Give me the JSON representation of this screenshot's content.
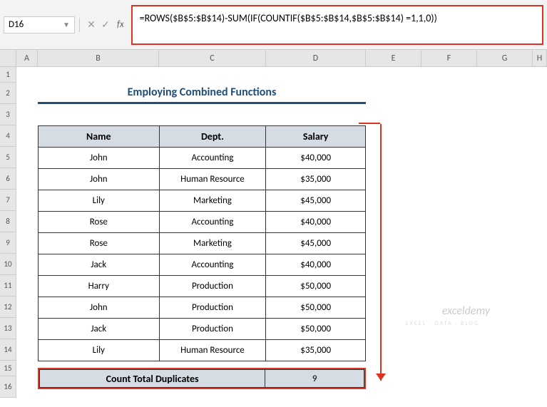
{
  "nameBox": {
    "cellRef": "D16"
  },
  "formulaBar": {
    "formula": "=ROWS($B$5:$B$14)-SUM(IF(COUNTIF($B$5:$B$14,$B$5:$B$14) =1,1,0))"
  },
  "columns": {
    "a": "A",
    "b": "B",
    "c": "C",
    "d": "D",
    "e": "E",
    "f": "F",
    "g": "G",
    "h": "H"
  },
  "rows": {
    "r1": "1",
    "r2": "2",
    "r3": "3",
    "r4": "4",
    "r5": "5",
    "r6": "6",
    "r7": "7",
    "r8": "8",
    "r9": "9",
    "r10": "10",
    "r11": "11",
    "r12": "12",
    "r13": "13",
    "r14": "14",
    "r15": "15",
    "r16": "16"
  },
  "title": "Employing Combined Functions",
  "headers": {
    "name": "Name",
    "dept": "Dept.",
    "salary": "Salary"
  },
  "data": [
    {
      "name": "John",
      "dept": "Accounting",
      "salary": "$40,000"
    },
    {
      "name": "John",
      "dept": "Human Resource",
      "salary": "$35,000"
    },
    {
      "name": "Lily",
      "dept": "Marketing",
      "salary": "$45,000"
    },
    {
      "name": "Rose",
      "dept": "Accounting",
      "salary": "$40,000"
    },
    {
      "name": "Rose",
      "dept": "Marketing",
      "salary": "$45,000"
    },
    {
      "name": "Jack",
      "dept": "Accounting",
      "salary": "$40,000"
    },
    {
      "name": "Harry",
      "dept": "Production",
      "salary": "$50,000"
    },
    {
      "name": "John",
      "dept": "Production",
      "salary": "$50,000"
    },
    {
      "name": "Jack",
      "dept": "Production",
      "salary": "$50,000"
    },
    {
      "name": "Lily",
      "dept": "Human Resource",
      "salary": "$35,000"
    }
  ],
  "totals": {
    "label": "Count Total Duplicates",
    "value": "9"
  },
  "watermark": {
    "main": "exceldemy",
    "sub": "EXCEL · DATA · BLOG"
  }
}
